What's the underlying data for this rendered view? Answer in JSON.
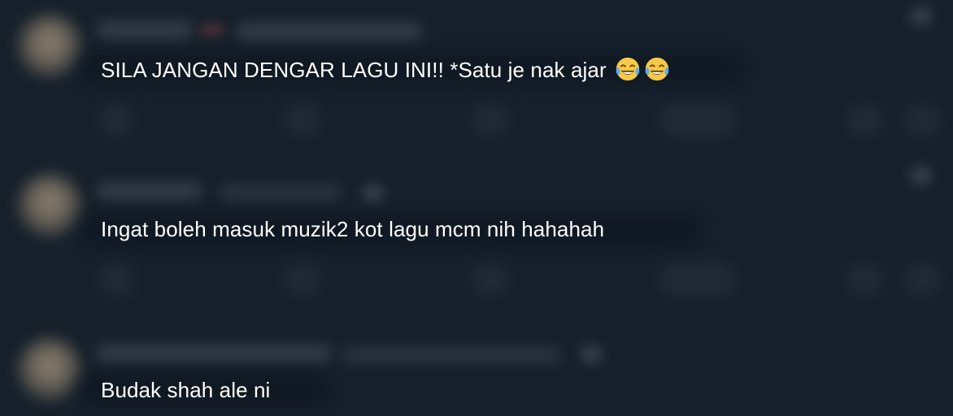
{
  "replies": [
    {
      "text": "SILA JANGAN DENGAR LAGU INI!! *Satu je nak ajar",
      "emojis": [
        "tears-of-joy-emoji",
        "tears-of-joy-emoji"
      ]
    },
    {
      "text": "Ingat boleh masuk muzik2 kot lagu mcm nih hahahah"
    },
    {
      "text": "Budak shah ale ni"
    }
  ],
  "colors": {
    "background": "#15202b",
    "text": "#ffffff"
  }
}
